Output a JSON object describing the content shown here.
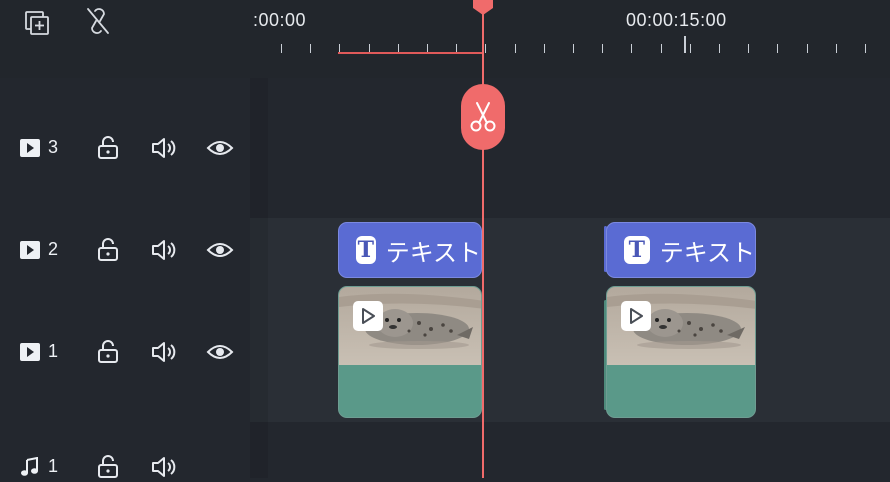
{
  "toolbar": {
    "add_track_icon": "add-track-icon",
    "unlink_icon": "unlink-icon"
  },
  "ruler": {
    "time_start": ":00:00",
    "time_mid": "00:00:15:00"
  },
  "tracks": [
    {
      "type": "video",
      "number": "3"
    },
    {
      "type": "video",
      "number": "2"
    },
    {
      "type": "video",
      "number": "1"
    },
    {
      "type": "audio",
      "number": "1"
    }
  ],
  "clips": {
    "title_label": "テキスト"
  },
  "colors": {
    "playhead": "#f06b6b",
    "title_clip": "#5a6bd3",
    "video_clip": "#5a9989",
    "background": "#23272e"
  }
}
